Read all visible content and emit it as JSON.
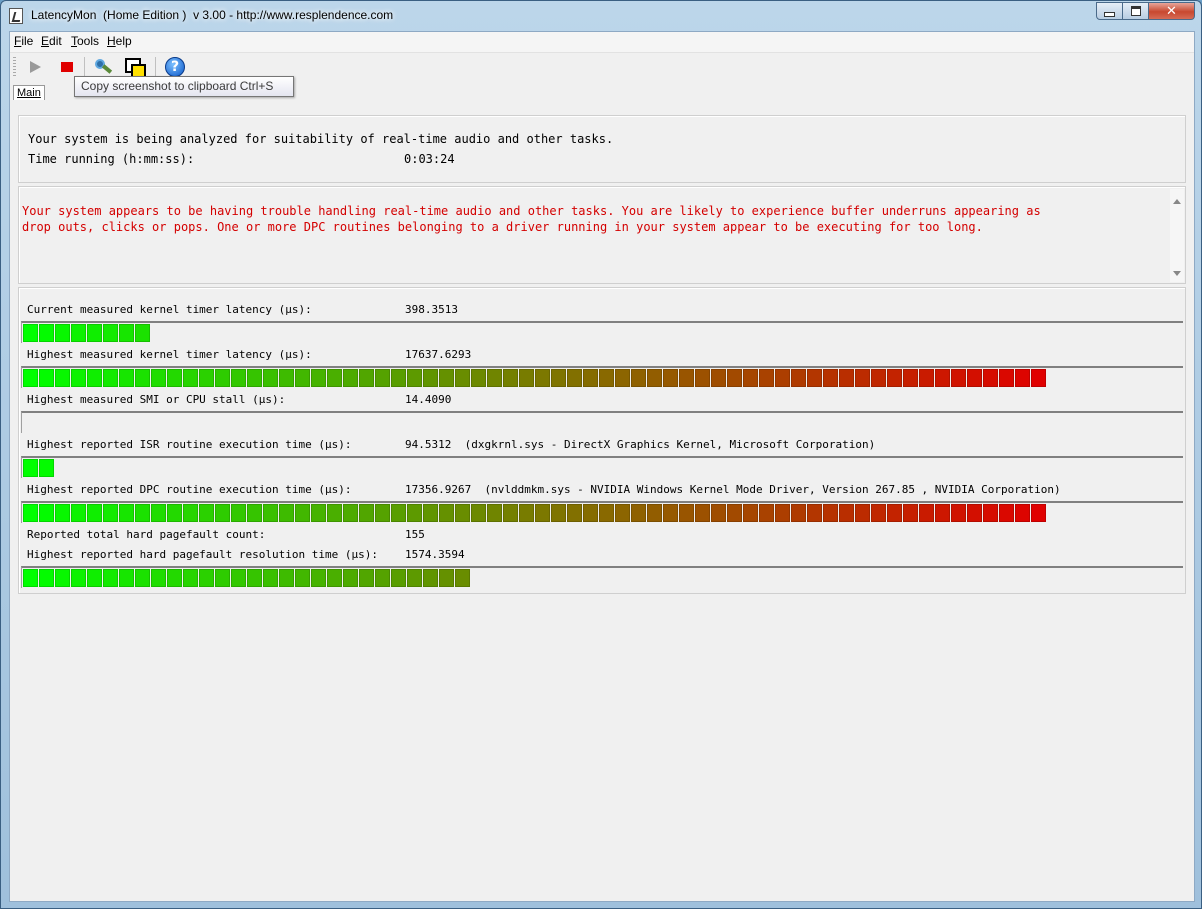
{
  "window": {
    "title": "LatencyMon  (Home Edition )  v 3.00 - http://www.resplendence.com"
  },
  "menu": [
    {
      "key": "F",
      "rest": "ile"
    },
    {
      "key": "E",
      "rest": "dit"
    },
    {
      "key": "T",
      "rest": "ools"
    },
    {
      "key": "H",
      "rest": "elp"
    }
  ],
  "toolbar": {
    "icons": [
      "play-icon",
      "stop-icon",
      "wrench-icon",
      "copy-screenshot-icon",
      "help-icon"
    ],
    "tooltip": "Copy screenshot to clipboard Ctrl+S"
  },
  "tabs": {
    "main": "Main"
  },
  "status": {
    "line1": "Your system is being analyzed for suitability of real-time audio and other tasks.",
    "time_label": "Time running (h:mm:ss):",
    "time_value": "0:03:24"
  },
  "verdict": {
    "line1": "Your system appears to be having trouble handling real-time audio and other tasks. You are likely to experience buffer underruns appearing as",
    "line2": "drop outs, clicks or pops. One or more DPC routines belonging to a driver running in your system appear to be executing for too long.",
    "color": "#d40000"
  },
  "metrics": [
    {
      "label": "Current measured kernel timer latency (µs):",
      "value": "398.3513",
      "detail": "",
      "segments": 8,
      "has_bar": true
    },
    {
      "label": "Highest measured kernel timer latency (µs):",
      "value": "17637.6293",
      "detail": "",
      "segments": 64,
      "has_bar": true
    },
    {
      "label": "Highest measured SMI or CPU stall (µs):",
      "value": "14.4090",
      "detail": "",
      "segments": 0,
      "has_bar": true
    },
    {
      "label": "Highest reported ISR routine execution time (µs):",
      "value": "94.5312",
      "detail": "(dxgkrnl.sys - DirectX Graphics Kernel, Microsoft Corporation)",
      "segments": 2,
      "has_bar": true
    },
    {
      "label": "Highest reported DPC routine execution time (µs):",
      "value": "17356.9267",
      "detail": "(nvlddmkm.sys - NVIDIA Windows Kernel Mode Driver, Version 267.85 , NVIDIA Corporation)",
      "segments": 64,
      "has_bar": true
    },
    {
      "label": "Reported total hard pagefault count:",
      "value": "155",
      "detail": "",
      "segments": 0,
      "has_bar": false
    },
    {
      "label": "Highest reported hard pagefault resolution time (µs):",
      "value": "1574.3594",
      "detail": "",
      "segments": 28,
      "has_bar": true
    }
  ],
  "colors": {
    "bar_low": "#00ff00",
    "bar_mid": "#7a7a00",
    "bar_high": "#e00000"
  }
}
